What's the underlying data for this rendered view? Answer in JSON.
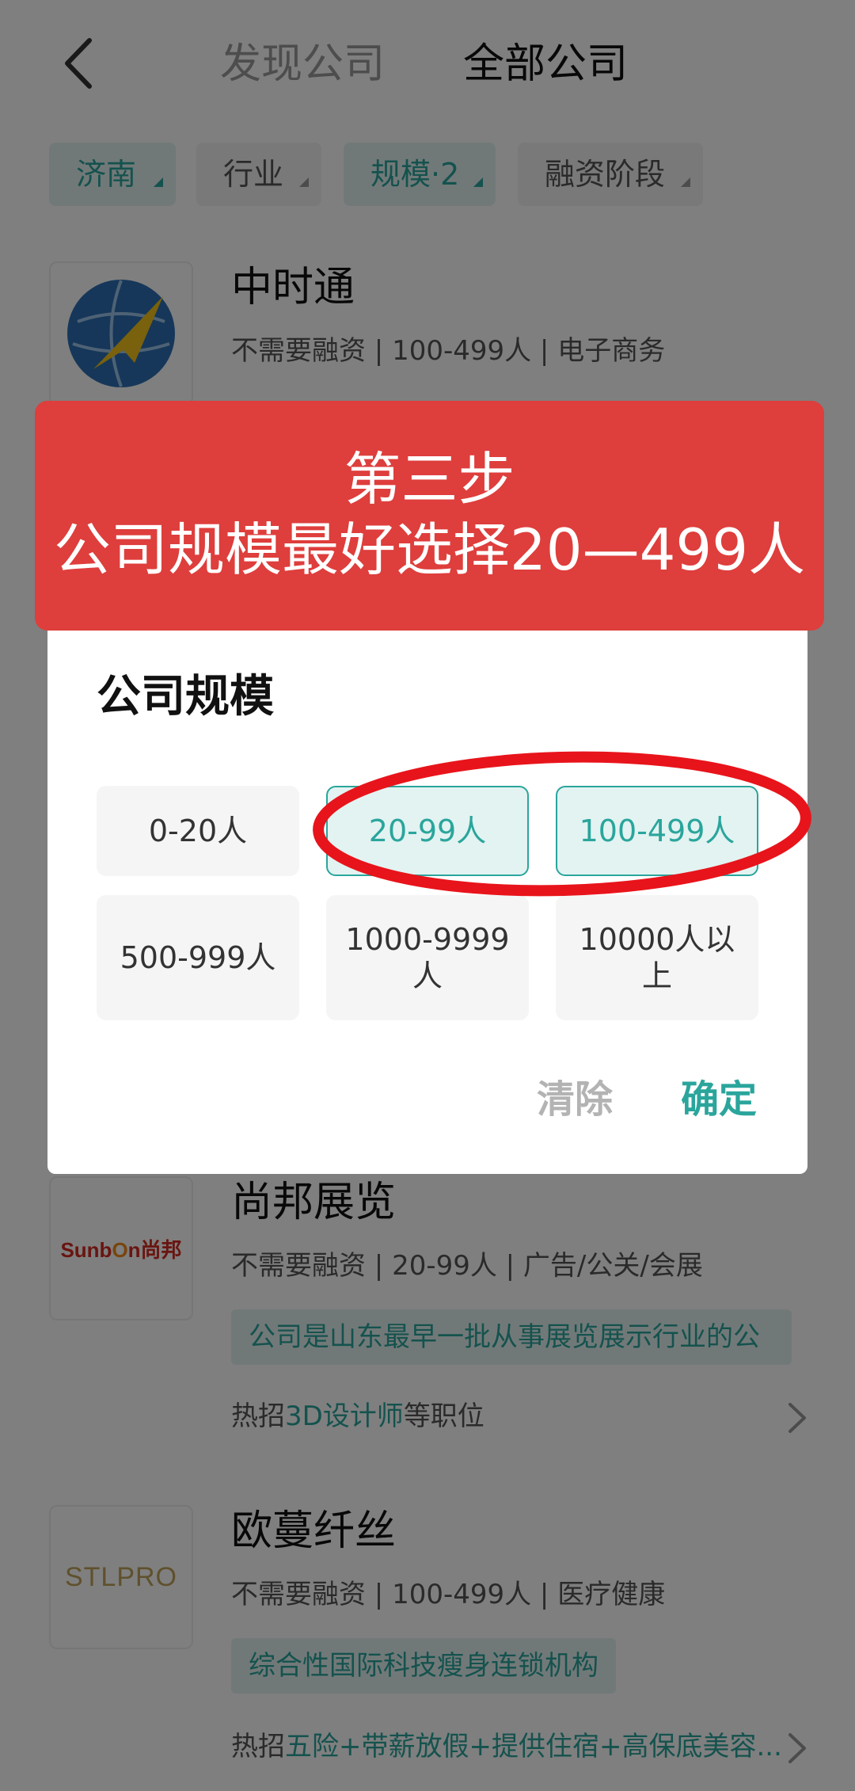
{
  "header": {
    "back_icon": "chevron-left-icon",
    "tab_discover": "发现公司",
    "tab_all": "全部公司"
  },
  "filters": [
    {
      "label": "济南",
      "active": true
    },
    {
      "label": "行业",
      "active": false
    },
    {
      "label": "规模·2",
      "active": true
    },
    {
      "label": "融资阶段",
      "active": false
    }
  ],
  "companies": [
    {
      "name": "中时通",
      "meta": "不需要融资 | 100-499人 | 电子商务"
    },
    {
      "name": "尚邦展览",
      "meta": "不需要融资 | 20-99人 | 广告/公关/会展",
      "tag": "公司是山东最早一批从事展览展示行业的公",
      "jobs_prefix": "热招",
      "jobs_highlight": "3D设计师",
      "jobs_suffix": "等职位",
      "logo_text": "Sunb",
      "logo_accent": "O",
      "logo_tail": "n尚邦"
    },
    {
      "name": "欧蔓纤丝",
      "meta": "不需要融资 | 100-499人 | 医疗健康",
      "tag": "综合性国际科技瘦身连锁机构",
      "jobs_prefix": "热招",
      "jobs_highlight": "五险+带薪放假+提供住宿+高保底美容...",
      "logo_text": "STLPRO"
    }
  ],
  "banner": {
    "line1": "第三步",
    "line2": "公司规模最好选择20—499人"
  },
  "dialog": {
    "title": "公司规模",
    "options": [
      {
        "label": "0-20人",
        "selected": false
      },
      {
        "label": "20-99人",
        "selected": true
      },
      {
        "label": "100-499人",
        "selected": true
      },
      {
        "label": "500-999人",
        "selected": false
      },
      {
        "label": "1000-9999人",
        "line1": "1000-9999",
        "line2": "人",
        "selected": false
      },
      {
        "label": "10000人以上",
        "line1": "10000人以",
        "line2": "上",
        "selected": false
      }
    ],
    "clear_label": "清除",
    "confirm_label": "确定"
  },
  "colors": {
    "accent": "#2aa59c",
    "banner": "#de3e3c",
    "annotation": "#e8141b"
  }
}
